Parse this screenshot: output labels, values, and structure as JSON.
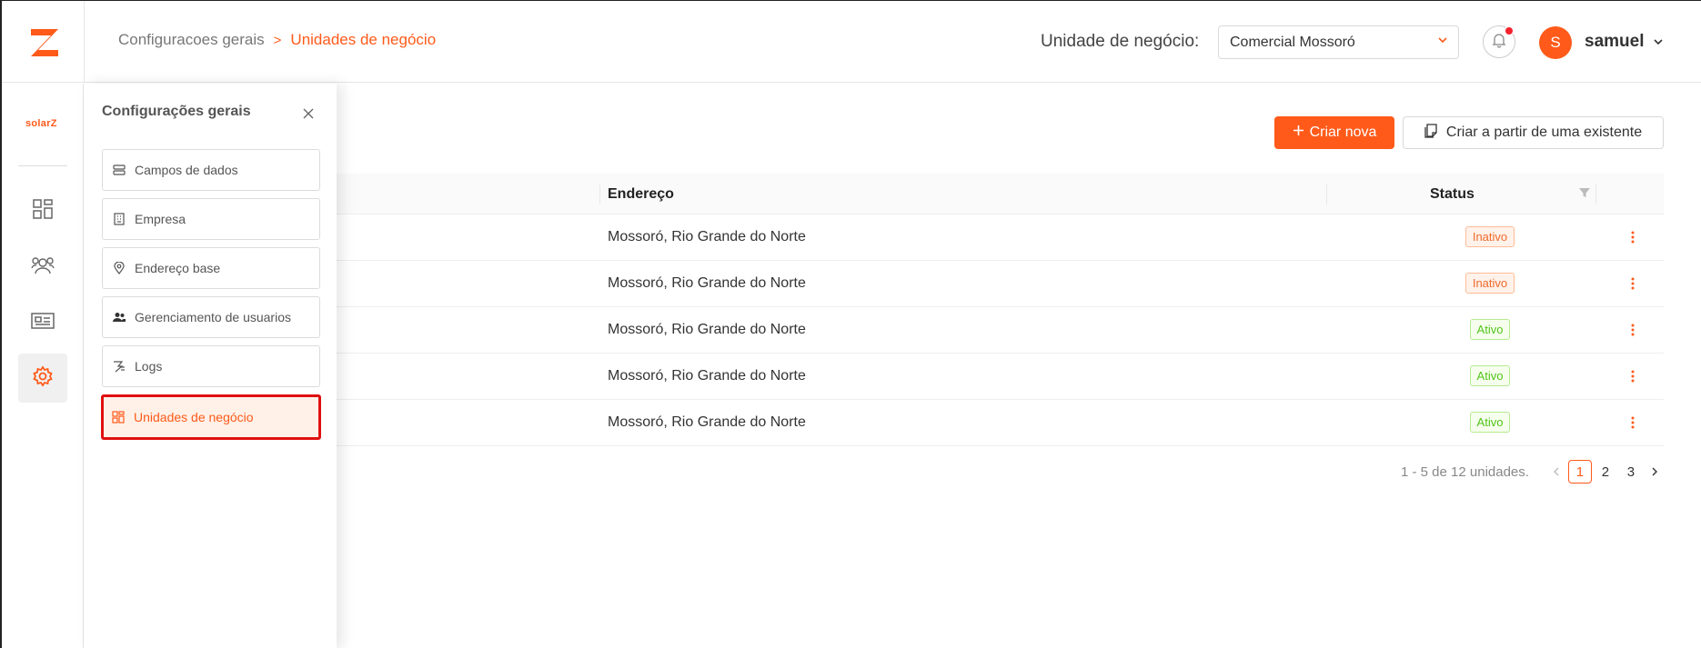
{
  "header": {
    "breadcrumb": {
      "parent": "Configuracoes gerais",
      "current": "Unidades de negócio"
    },
    "business_unit_label": "Unidade de negócio:",
    "business_unit_value": "Comercial Mossoró",
    "avatar_initial": "S",
    "username": "samuel"
  },
  "rail": {
    "brand": "solarZ"
  },
  "settings_panel": {
    "title": "Configurações gerais",
    "items": [
      {
        "label": "Campos de dados",
        "icon": "database-icon"
      },
      {
        "label": "Empresa",
        "icon": "building-icon"
      },
      {
        "label": "Endereço base",
        "icon": "location-pin-icon"
      },
      {
        "label": "Gerenciamento de usuarios",
        "icon": "users-icon"
      },
      {
        "label": "Logs",
        "icon": "logs-icon"
      },
      {
        "label": "Unidades de negócio",
        "icon": "business-units-icon",
        "active": true
      }
    ]
  },
  "actions": {
    "create_new": "Criar nova",
    "create_from_existing": "Criar a partir de uma existente"
  },
  "table": {
    "columns": {
      "address": "Endereço",
      "status": "Status"
    },
    "rows": [
      {
        "address": "Mossoró, Rio Grande do Norte",
        "status": "Inativo"
      },
      {
        "address": "Mossoró, Rio Grande do Norte",
        "status": "Inativo"
      },
      {
        "address": "Mossoró, Rio Grande do Norte",
        "status": "Ativo"
      },
      {
        "address": "Mossoró, Rio Grande do Norte",
        "status": "Ativo"
      },
      {
        "address": "Mossoró, Rio Grande do Norte",
        "status": "Ativo"
      }
    ]
  },
  "pagination": {
    "summary": "1 - 5 de 12 unidades.",
    "pages": [
      "1",
      "2",
      "3"
    ],
    "current": "1"
  },
  "colors": {
    "accent": "#ff5a1a",
    "inactive": "#f06a2c",
    "active": "#52c41a"
  }
}
